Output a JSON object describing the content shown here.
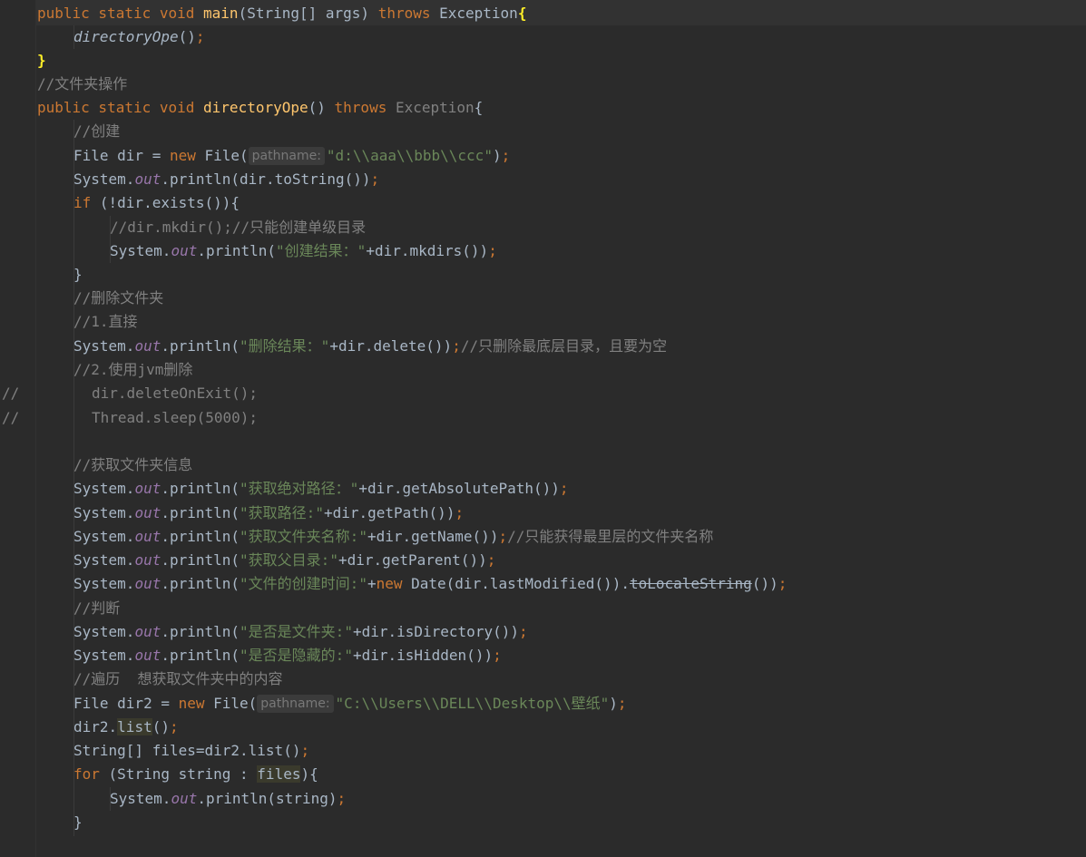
{
  "code": {
    "l1": {
      "kw1": "public static void ",
      "fn": "main",
      "p1": "(String[] args) ",
      "kw2": "throws",
      "p2": " Exception",
      "brace": "{"
    },
    "l2": {
      "call": "directoryOpe",
      "p": "()",
      "sc": ";"
    },
    "l3": {
      "brace": "}"
    },
    "l4": {
      "cm": "//文件夹操作"
    },
    "l5": {
      "kw1": "public static void ",
      "fn": "directoryOpe",
      "p1": "() ",
      "kw2": "throws",
      "p2": " ",
      "ex": "Exception",
      "p3": "{"
    },
    "l6": {
      "cm": "//创建"
    },
    "l7": {
      "p1": "File dir = ",
      "kw": "new",
      "p2": " File(",
      "hint": "pathname:",
      "str": "\"d:\\\\aaa\\\\bbb\\\\ccc\"",
      "p3": ")",
      "sc": ";"
    },
    "l8": {
      "p1": "System.",
      "out": "out",
      "p2": ".println(dir.toString())",
      "sc": ";"
    },
    "l9": {
      "kw": "if",
      "p": " (!dir.exists()){"
    },
    "l10": {
      "cm": "//dir.mkdir();//只能创建单级目录"
    },
    "l11": {
      "p1": "System.",
      "out": "out",
      "p2": ".println(",
      "str": "\"创建结果：\"",
      "p3": "+dir.mkdirs())",
      "sc": ";"
    },
    "l12": {
      "p": "}"
    },
    "l13": {
      "cm": "//删除文件夹"
    },
    "l14": {
      "cm": "//1.直接"
    },
    "l15": {
      "p1": "System.",
      "out": "out",
      "p2": ".println(",
      "str": "\"删除结果：\"",
      "p3": "+dir.delete())",
      "sc": ";",
      "cm": "//只删除最底层目录，且要为空"
    },
    "l16": {
      "cm": "//2.使用jvm删除"
    },
    "l17": {
      "gut": "//",
      "cm": "dir.deleteOnExit();"
    },
    "l18": {
      "gut": "//",
      "cm": "Thread.sleep(5000);"
    },
    "l19": {
      "cm": "//获取文件夹信息"
    },
    "l20": {
      "p1": "System.",
      "out": "out",
      "p2": ".println(",
      "str": "\"获取绝对路径：\"",
      "p3": "+dir.getAbsolutePath())",
      "sc": ";"
    },
    "l21": {
      "p1": "System.",
      "out": "out",
      "p2": ".println(",
      "str": "\"获取路径:\"",
      "p3": "+dir.getPath())",
      "sc": ";"
    },
    "l22": {
      "p1": "System.",
      "out": "out",
      "p2": ".println(",
      "str": "\"获取文件夹名称:\"",
      "p3": "+dir.getName())",
      "sc": ";",
      "cm": "//只能获得最里层的文件夹名称"
    },
    "l23": {
      "p1": "System.",
      "out": "out",
      "p2": ".println(",
      "str": "\"获取父目录:\"",
      "p3": "+dir.getParent())",
      "sc": ";"
    },
    "l24": {
      "p1": "System.",
      "out": "out",
      "p2": ".println(",
      "str": "\"文件的创建时间:\"",
      "p3": "+",
      "kw": "new",
      "p4": " Date(dir.lastModified()).",
      "dep": "toLocaleString",
      "p5": "())",
      "sc": ";"
    },
    "l25": {
      "cm": "//判断"
    },
    "l26": {
      "p1": "System.",
      "out": "out",
      "p2": ".println(",
      "str": "\"是否是文件夹:\"",
      "p3": "+dir.isDirectory())",
      "sc": ";"
    },
    "l27": {
      "p1": "System.",
      "out": "out",
      "p2": ".println(",
      "str": "\"是否是隐藏的:\"",
      "p3": "+dir.isHidden())",
      "sc": ";"
    },
    "l28": {
      "cm": "//遍历  想获取文件夹中的内容"
    },
    "l29": {
      "p1": "File dir2 = ",
      "kw": "new",
      "p2": " File(",
      "hint": "pathname:",
      "str": "\"C:\\\\Users\\\\DELL\\\\Desktop\\\\壁纸\"",
      "p3": ")",
      "sc": ";"
    },
    "l30": {
      "p1": "dir2.",
      "hl": "list",
      "p2": "()",
      "sc": ";"
    },
    "l31": {
      "p1": "String[] files=dir2.list()",
      "sc": ";"
    },
    "l32": {
      "kw": "for",
      "p1": " (String string : ",
      "hl": "files",
      "p2": "){"
    },
    "l33": {
      "p1": "System.",
      "out": "out",
      "p2": ".println(string)",
      "sc": ";"
    },
    "l34": {
      "p": "}"
    }
  }
}
